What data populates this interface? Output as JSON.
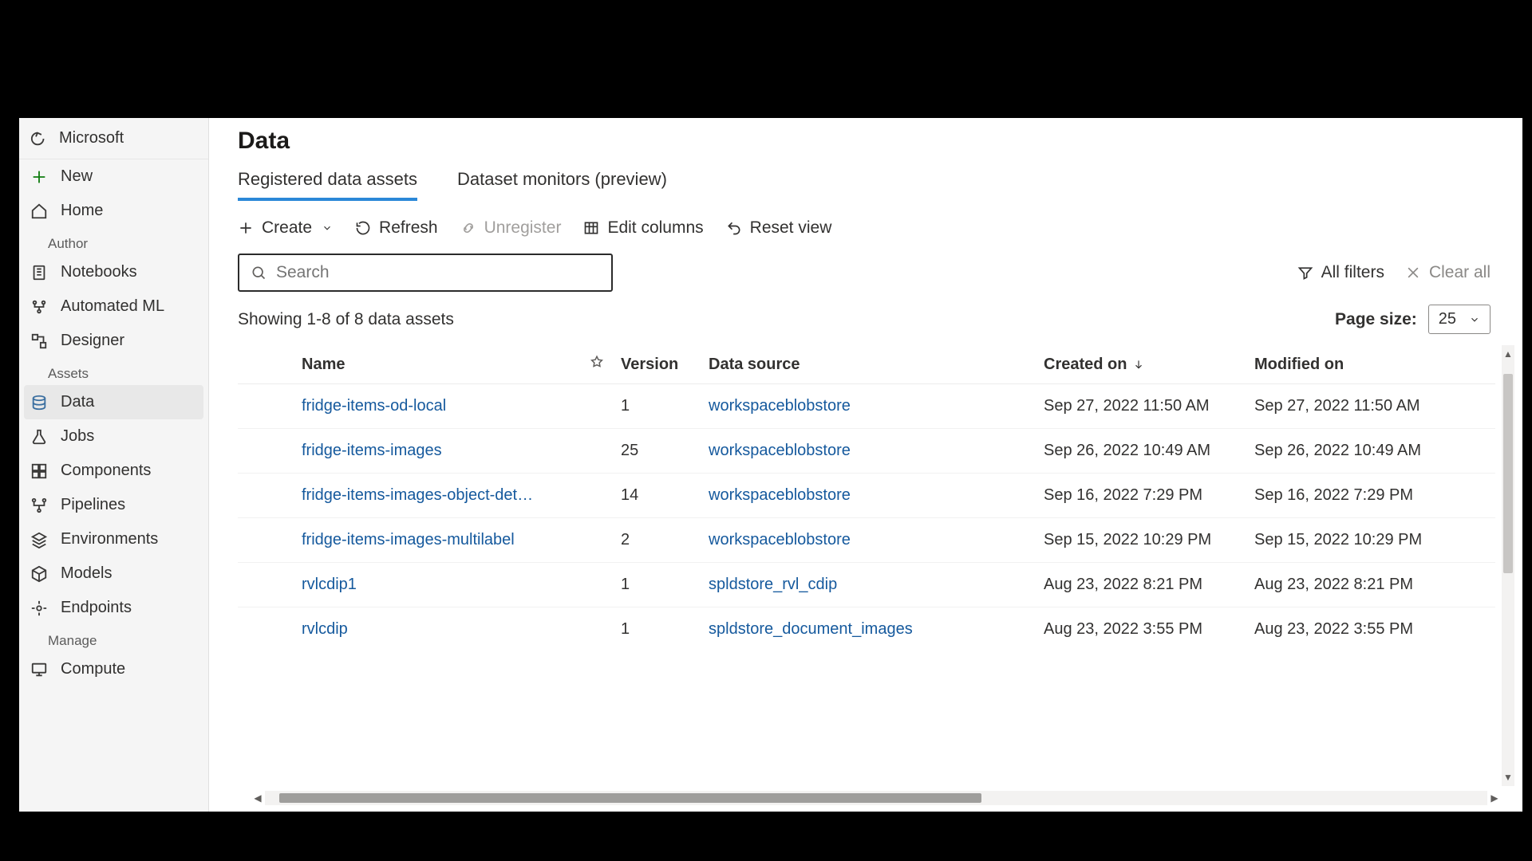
{
  "sidebar": {
    "back_label": "Microsoft",
    "items": [
      {
        "label": "New"
      },
      {
        "label": "Home"
      }
    ],
    "author_label": "Author",
    "author_items": [
      {
        "label": "Notebooks"
      },
      {
        "label": "Automated ML"
      },
      {
        "label": "Designer"
      }
    ],
    "assets_label": "Assets",
    "assets_items": [
      {
        "label": "Data"
      },
      {
        "label": "Jobs"
      },
      {
        "label": "Components"
      },
      {
        "label": "Pipelines"
      },
      {
        "label": "Environments"
      },
      {
        "label": "Models"
      },
      {
        "label": "Endpoints"
      }
    ],
    "manage_label": "Manage",
    "manage_items": [
      {
        "label": "Compute"
      }
    ]
  },
  "page": {
    "title": "Data",
    "tabs": [
      {
        "label": "Registered data assets"
      },
      {
        "label": "Dataset monitors (preview)"
      }
    ]
  },
  "toolbar": {
    "create": "Create",
    "refresh": "Refresh",
    "unregister": "Unregister",
    "edit_columns": "Edit columns",
    "reset_view": "Reset view"
  },
  "search": {
    "placeholder": "Search"
  },
  "filters": {
    "all": "All filters",
    "clear": "Clear all"
  },
  "stats": {
    "showing": "Showing 1-8 of 8 data assets",
    "page_size_label": "Page size:",
    "page_size_value": "25"
  },
  "table": {
    "columns": {
      "name": "Name",
      "version": "Version",
      "source": "Data source",
      "created": "Created on",
      "modified": "Modified on"
    },
    "rows": [
      {
        "name": "fridge-items-od-local",
        "version": "1",
        "source": "workspaceblobstore",
        "created": "Sep 27, 2022 11:50 AM",
        "modified": "Sep 27, 2022 11:50 AM"
      },
      {
        "name": "fridge-items-images",
        "version": "25",
        "source": "workspaceblobstore",
        "created": "Sep 26, 2022 10:49 AM",
        "modified": "Sep 26, 2022 10:49 AM"
      },
      {
        "name": "fridge-items-images-object-det…",
        "version": "14",
        "source": "workspaceblobstore",
        "created": "Sep 16, 2022 7:29 PM",
        "modified": "Sep 16, 2022 7:29 PM"
      },
      {
        "name": "fridge-items-images-multilabel",
        "version": "2",
        "source": "workspaceblobstore",
        "created": "Sep 15, 2022 10:29 PM",
        "modified": "Sep 15, 2022 10:29 PM"
      },
      {
        "name": "rvlcdip1",
        "version": "1",
        "source": "spldstore_rvl_cdip",
        "created": "Aug 23, 2022 8:21 PM",
        "modified": "Aug 23, 2022 8:21 PM"
      },
      {
        "name": "rvlcdip",
        "version": "1",
        "source": "spldstore_document_images",
        "created": "Aug 23, 2022 3:55 PM",
        "modified": "Aug 23, 2022 3:55 PM"
      }
    ]
  }
}
